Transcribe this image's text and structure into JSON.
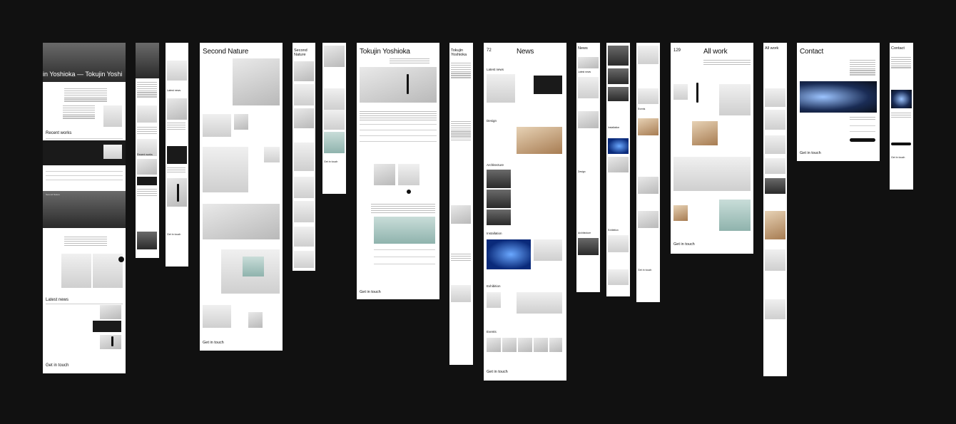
{
  "board": {
    "background": "#111111"
  },
  "home": {
    "hero_title": "jin Yoshioka — Tokujin Yoshi",
    "recent_works": "Recent works",
    "project": "Second Nature",
    "latest_news": "Latest news",
    "get_in_touch": "Get in touch"
  },
  "narrow": {
    "latest_news": "Latest news",
    "recent_works": "Recent works",
    "get_in_touch": "Get in touch"
  },
  "project_page": {
    "title": "Second Nature",
    "get_in_touch": "Get in touch"
  },
  "project_mobile": {
    "title": "Second Nature",
    "get_in_touch": "Get in touch"
  },
  "about": {
    "title": "Tokujin Yoshioka",
    "get_in_touch": "Get in touch"
  },
  "about_mobile": {
    "title": "Tokujin Yoshioka"
  },
  "news": {
    "count": "72",
    "title": "News",
    "sections": [
      "Latest news",
      "Design",
      "Architecture",
      "Installation",
      "Exhibition",
      "Events"
    ],
    "get_in_touch": "Get in touch"
  },
  "news_mobile": {
    "title": "News",
    "sections": [
      "Latest news",
      "Design",
      "Architecture"
    ]
  },
  "news_mobile2": {
    "sections": [
      "Installation",
      "Exhibition"
    ]
  },
  "news_mobile3": {
    "sections": [
      "Events"
    ],
    "get_in_touch": "Get in touch"
  },
  "all_work": {
    "count": "129",
    "title": "All work",
    "get_in_touch": "Get in touch"
  },
  "all_work_mobile": {
    "title": "All work"
  },
  "contact": {
    "title": "Contact",
    "get_in_touch": "Get in touch"
  },
  "contact_mobile": {
    "title": "Contact",
    "get_in_touch": "Get in touch"
  }
}
